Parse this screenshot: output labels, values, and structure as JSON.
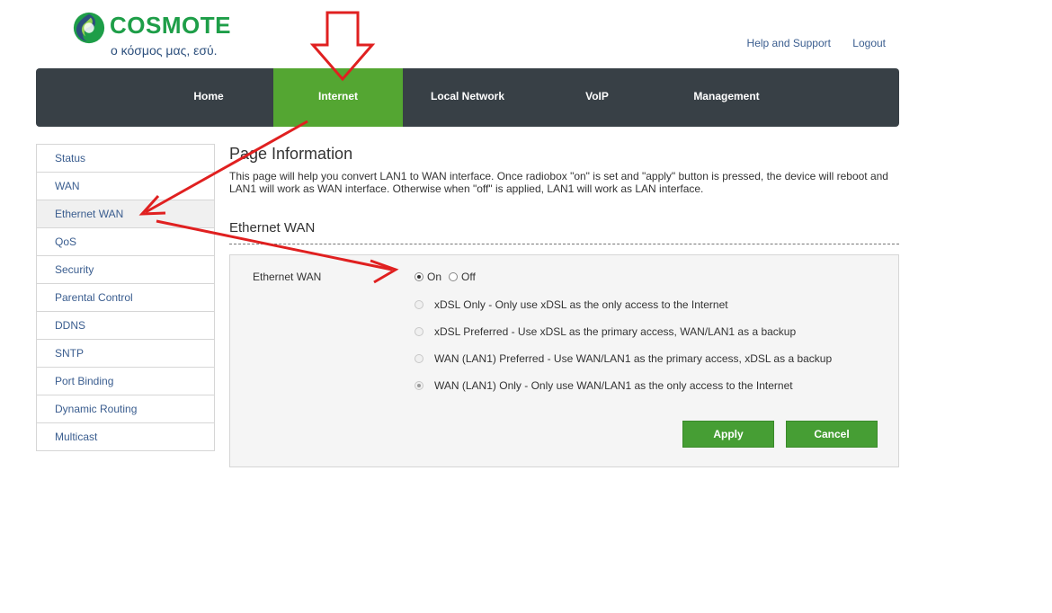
{
  "brand": {
    "name": "COSMOTE",
    "tagline": "ο κόσμος μας, εσύ.",
    "colors": {
      "green": "#1e9e48",
      "blue": "#2c4f7c",
      "nav_bg": "#384046",
      "nav_active": "#54a632",
      "button": "#469e34"
    }
  },
  "top_links": [
    {
      "label": "Help and Support"
    },
    {
      "label": "Logout"
    }
  ],
  "nav": {
    "items": [
      {
        "label": "Home"
      },
      {
        "label": "Internet",
        "active": true
      },
      {
        "label": "Local Network"
      },
      {
        "label": "VoIP"
      },
      {
        "label": "Management"
      }
    ]
  },
  "sidebar": {
    "items": [
      {
        "label": "Status"
      },
      {
        "label": "WAN"
      },
      {
        "label": "Ethernet WAN",
        "active": true
      },
      {
        "label": "QoS"
      },
      {
        "label": "Security"
      },
      {
        "label": "Parental Control"
      },
      {
        "label": "DDNS"
      },
      {
        "label": "SNTP"
      },
      {
        "label": "Port Binding"
      },
      {
        "label": "Dynamic Routing"
      },
      {
        "label": "Multicast"
      }
    ]
  },
  "main": {
    "page_title": "Page Information",
    "page_description": "This page will help you convert LAN1 to WAN interface. Once radiobox \"on\" is set and \"apply\" button is pressed, the device will reboot and LAN1 will work as WAN interface. Otherwise when \"off\" is applied, LAN1 will work as LAN interface.",
    "section_title": "Ethernet WAN",
    "field_label": "Ethernet WAN",
    "on_label": "On",
    "off_label": "Off",
    "on_selected": true,
    "options": [
      {
        "label": "xDSL Only - Only use xDSL as the only access to the Internet",
        "selected": false
      },
      {
        "label": "xDSL Preferred - Use xDSL as the primary access, WAN/LAN1 as a backup",
        "selected": false
      },
      {
        "label": "WAN (LAN1) Preferred - Use WAN/LAN1 as the primary access, xDSL as a backup",
        "selected": false
      },
      {
        "label": "WAN (LAN1) Only - Only use WAN/LAN1 as the only access to the Internet",
        "selected": true
      }
    ],
    "apply_label": "Apply",
    "cancel_label": "Cancel"
  },
  "annotations": {
    "color": "#e02020"
  }
}
